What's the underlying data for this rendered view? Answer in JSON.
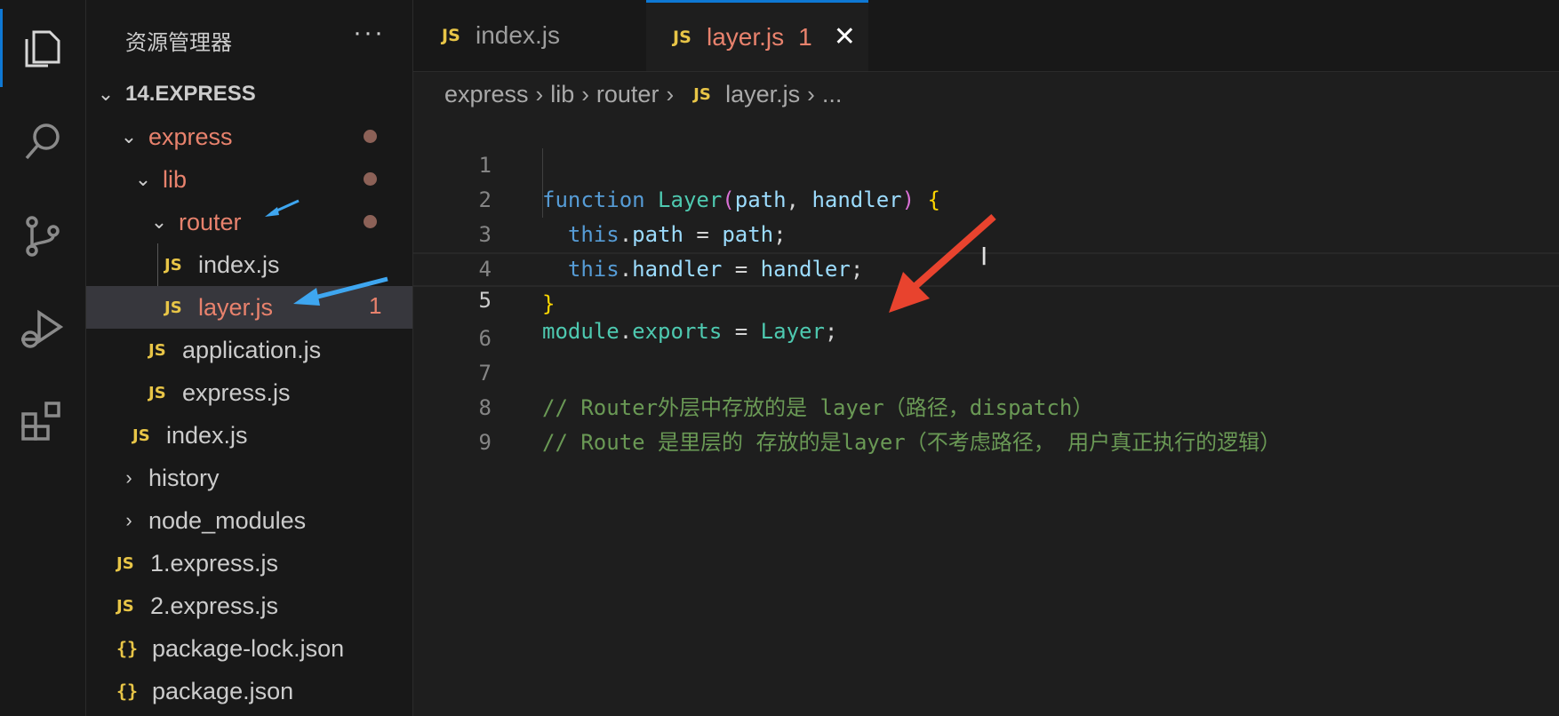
{
  "activity_bar": {
    "items": [
      {
        "name": "explorer-icon",
        "active": true
      },
      {
        "name": "search-icon",
        "active": false
      },
      {
        "name": "source-control-icon",
        "active": false
      },
      {
        "name": "run-debug-icon",
        "active": false
      },
      {
        "name": "extensions-icon",
        "active": false
      }
    ]
  },
  "sidebar": {
    "title": "资源管理器",
    "more": "···",
    "root": "14.EXPRESS",
    "items": [
      {
        "label": "express",
        "type": "folder",
        "expanded": true,
        "modified": true
      },
      {
        "label": "lib",
        "type": "folder",
        "expanded": true,
        "modified": true
      },
      {
        "label": "router",
        "type": "folder",
        "expanded": true,
        "modified": true
      },
      {
        "label": "index.js",
        "type": "js",
        "badge": "JS"
      },
      {
        "label": "layer.js",
        "type": "js",
        "badge": "JS",
        "count": "1",
        "selected": true
      },
      {
        "label": "application.js",
        "type": "js",
        "badge": "JS"
      },
      {
        "label": "express.js",
        "type": "js",
        "badge": "JS"
      },
      {
        "label": "index.js",
        "type": "js",
        "badge": "JS"
      },
      {
        "label": "history",
        "type": "folder",
        "expanded": false
      },
      {
        "label": "node_modules",
        "type": "folder",
        "expanded": false
      },
      {
        "label": "1.express.js",
        "type": "js",
        "badge": "JS"
      },
      {
        "label": "2.express.js",
        "type": "js",
        "badge": "JS"
      },
      {
        "label": "package-lock.json",
        "type": "json",
        "badge": "{}"
      },
      {
        "label": "package.json",
        "type": "json",
        "badge": "{}"
      }
    ]
  },
  "tabs": [
    {
      "badge": "JS",
      "label": "index.js",
      "active": false
    },
    {
      "badge": "JS",
      "label": "layer.js",
      "active": true,
      "count": "1",
      "close": "✕"
    }
  ],
  "breadcrumb": {
    "parts": [
      "express",
      "lib",
      "router"
    ],
    "file_badge": "JS",
    "file": "layer.js",
    "tail": "..."
  },
  "editor": {
    "line_numbers": [
      "1",
      "2",
      "3",
      "4",
      "5",
      "6",
      "7",
      "8",
      "9"
    ],
    "current_line": "5",
    "comment_line_7": "// Router外层中存放的是 layer（路径，dispatch）",
    "comment_line_8": "// Route 是里层的 存放的是layer（不考虑路径， 用户真正执行的逻辑）"
  },
  "annotations": {
    "arrow_blue_color": "#3ea6f0",
    "arrow_red_color": "#e8432e"
  },
  "colors": {
    "modified": "#e8826d",
    "js_badge": "#e8c547",
    "accent": "#0e78d4"
  }
}
